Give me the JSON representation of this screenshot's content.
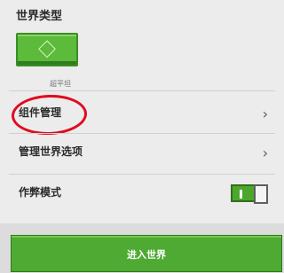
{
  "world_settings": {
    "world_type": {
      "title": "世界类型",
      "option_label": "超平坦",
      "icon": "diamond-icon"
    },
    "rows": [
      {
        "label": "组件管理",
        "chevron": "›"
      },
      {
        "label": "管理世界选项",
        "chevron": "›"
      },
      {
        "label": "作弊模式",
        "toggle_state": "on"
      }
    ]
  },
  "footer": {
    "enter_button_label": "进入世界"
  },
  "colors": {
    "button_green": "#4faa33",
    "annotation_red": "#e10a20"
  }
}
